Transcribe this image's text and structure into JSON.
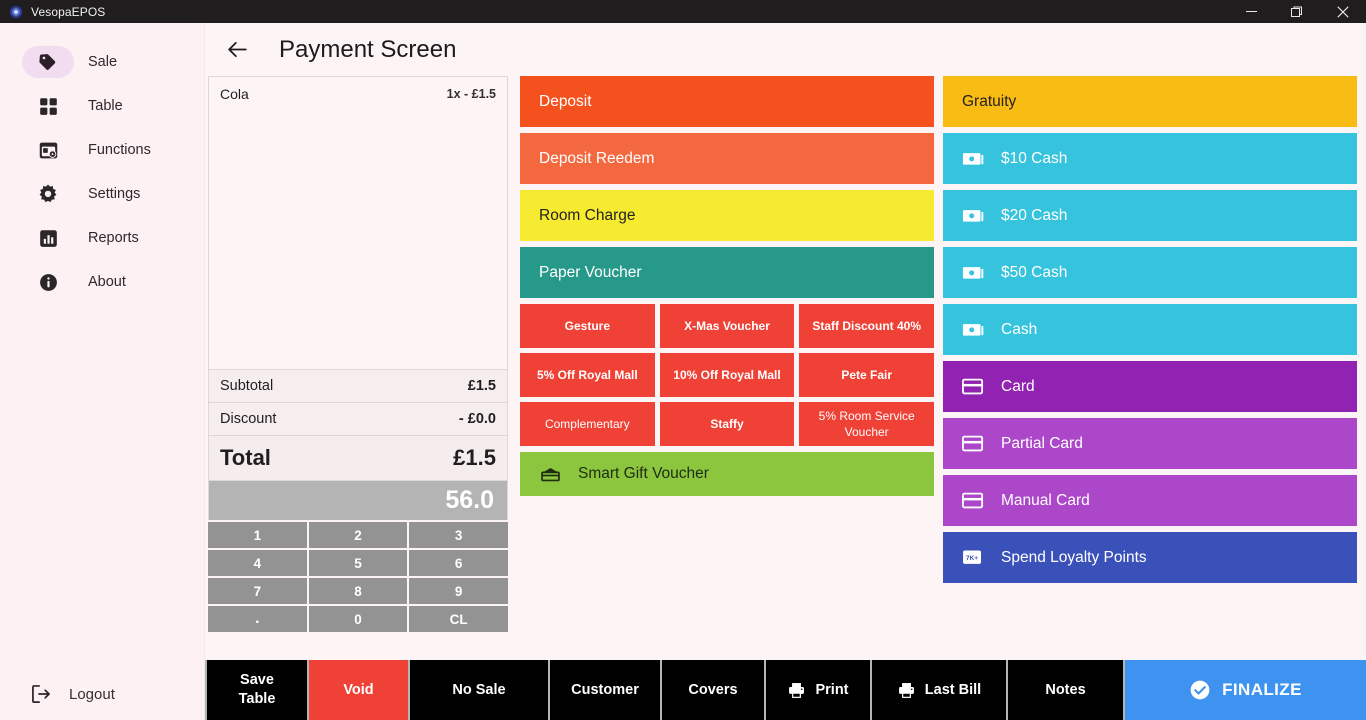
{
  "window": {
    "app_title": "VesopaEPOS",
    "logo_icon": "app-logo-icon",
    "minimize_label": "Minimize",
    "maximize_label": "Maximize",
    "close_label": "Close"
  },
  "sidebar": {
    "items": [
      {
        "label": "Sale",
        "icon": "tag-icon",
        "active": true
      },
      {
        "label": "Table",
        "icon": "grid-icon",
        "active": false
      },
      {
        "label": "Functions",
        "icon": "functions-icon",
        "active": false
      },
      {
        "label": "Settings",
        "icon": "gear-icon",
        "active": false
      },
      {
        "label": "Reports",
        "icon": "bar-chart-icon",
        "active": false
      },
      {
        "label": "About",
        "icon": "info-icon",
        "active": false
      }
    ],
    "logout": {
      "label": "Logout",
      "icon": "logout-icon"
    }
  },
  "header": {
    "back_icon": "arrow-left-icon",
    "title": "Payment Screen"
  },
  "ticket": {
    "items": [
      {
        "name": "Cola",
        "qty_price": "1x - £1.5"
      }
    ],
    "subtotal_label": "Subtotal",
    "subtotal_value": "£1.5",
    "discount_label": "Discount",
    "discount_value": "- £0.0",
    "total_label": "Total",
    "total_value": "£1.5",
    "amount_entry": "56.0",
    "keypad": [
      "1",
      "2",
      "3",
      "4",
      "5",
      "6",
      "7",
      "8",
      "9",
      ".",
      "0",
      "CL"
    ]
  },
  "payments": {
    "middle_column": [
      {
        "label": "Deposit",
        "color": "#f4511e",
        "text_color": "#ffffff"
      },
      {
        "label": "Deposit Reedem",
        "color": "#f4683f",
        "text_color": "#ffffff"
      },
      {
        "label": "Room Charge",
        "color": "#f6eb31",
        "text_color": "#26221f"
      },
      {
        "label": "Paper Voucher",
        "color": "#26998a",
        "text_color": "#ffffff"
      }
    ],
    "voucher_grid": [
      "Gesture",
      "X-Mas Voucher",
      "Staff Discount 40%",
      "5% Off Royal Mall",
      "10% Off Royal Mall",
      "Pete Fair",
      "Complementary",
      "Staffy",
      "5% Room Service Voucher"
    ],
    "voucher_color": "#ef4135",
    "gift": {
      "label": "Smart Gift Voucher",
      "icon": "gift-voucher-icon",
      "color": "#8cc63f"
    },
    "right_column": [
      {
        "label": "Gratuity",
        "icon": null,
        "color": "#f9bc15",
        "text_color": "#26221f"
      },
      {
        "label": "$10 Cash",
        "icon": "cash-icon",
        "color": "#36c3dd",
        "text_color": "#ffffff"
      },
      {
        "label": "$20 Cash",
        "icon": "cash-icon",
        "color": "#36c3dd",
        "text_color": "#ffffff"
      },
      {
        "label": "$50 Cash",
        "icon": "cash-icon",
        "color": "#36c3dd",
        "text_color": "#ffffff"
      },
      {
        "label": "Cash",
        "icon": "cash-icon",
        "color": "#36c3dd",
        "text_color": "#ffffff"
      },
      {
        "label": "Card",
        "icon": "card-icon",
        "color": "#9222b2",
        "text_color": "#ffffff"
      },
      {
        "label": "Partial Card",
        "icon": "card-icon",
        "color": "#ac47c9",
        "text_color": "#ffffff"
      },
      {
        "label": "Manual Card",
        "icon": "card-icon",
        "color": "#ac47c9",
        "text_color": "#ffffff"
      },
      {
        "label": "Spend Loyalty Points",
        "icon": "loyalty-icon",
        "color": "#3a51ba",
        "text_color": "#ffffff"
      }
    ]
  },
  "actionbar": {
    "buttons": [
      {
        "label": "Save\nTable",
        "icon": null,
        "color": "#000000"
      },
      {
        "label": "Void",
        "icon": null,
        "color": "#ef4135"
      },
      {
        "label": "No Sale",
        "icon": null,
        "color": "#000000"
      },
      {
        "label": "Customer",
        "icon": null,
        "color": "#000000"
      },
      {
        "label": "Covers",
        "icon": null,
        "color": "#000000"
      },
      {
        "label": "Print",
        "icon": "printer-icon",
        "color": "#000000"
      },
      {
        "label": "Last Bill",
        "icon": "printer-icon",
        "color": "#000000"
      },
      {
        "label": "Notes",
        "icon": null,
        "color": "#000000"
      },
      {
        "label": "FINALIZE",
        "icon": "check-circle-icon",
        "color": "#3d93ef"
      }
    ]
  },
  "colors": {
    "app_background": "#fdf4f6",
    "sidebar_background": "#fdf1f4",
    "active_pill": "#f2ddf0",
    "titlebar": "#201d1e",
    "keypad_key": "#939393",
    "amount_display": "#b4b4b4",
    "accent_finalize": "#3d93ef"
  }
}
